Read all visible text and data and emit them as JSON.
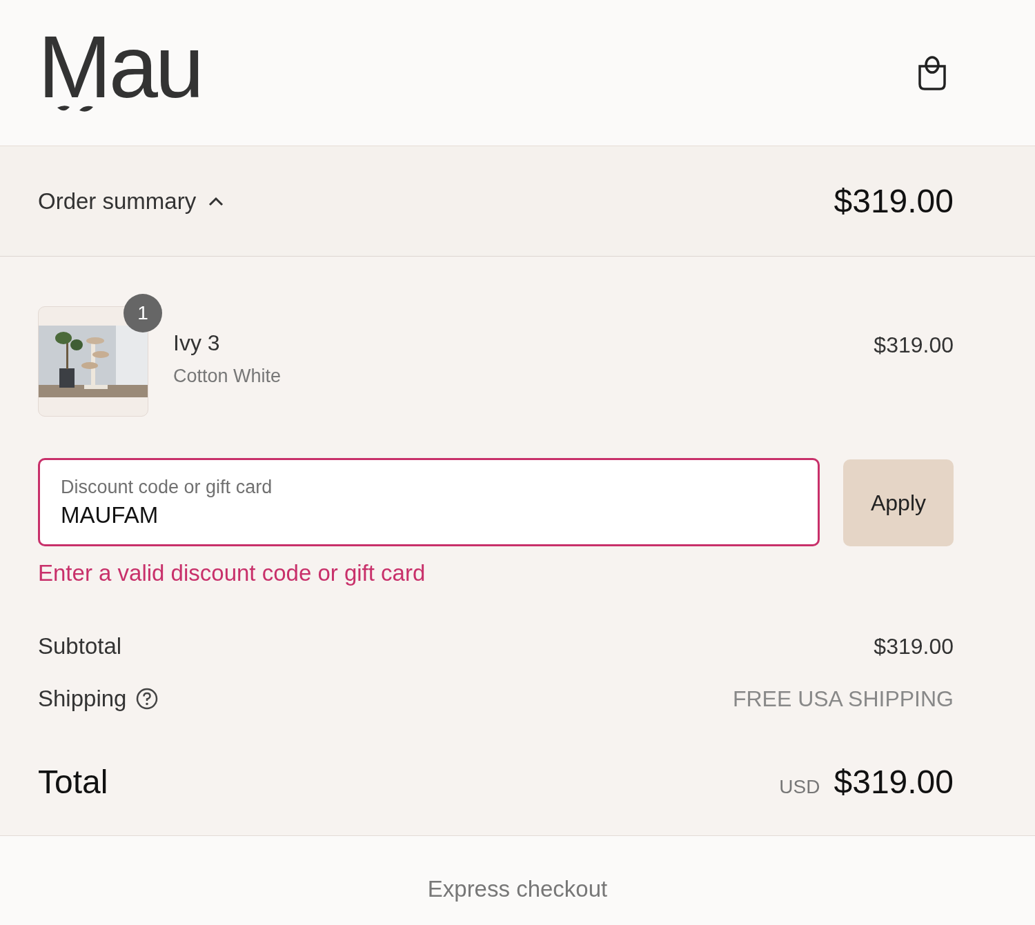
{
  "header": {
    "logo": "Mau"
  },
  "summary_toggle": {
    "label": "Order summary",
    "expanded": true,
    "total": "$319.00"
  },
  "items": [
    {
      "quantity": "1",
      "name": "Ivy 3",
      "variant": "Cotton White",
      "price": "$319.00"
    }
  ],
  "discount": {
    "label": "Discount code or gift card",
    "value": "MAUFAM",
    "invalid": true,
    "error": "Enter a valid discount code or gift card",
    "button": "Apply"
  },
  "lines": [
    {
      "kind": "amount",
      "label": "Subtotal",
      "value": "$319.00"
    },
    {
      "kind": "shipping",
      "label": "Shipping",
      "value": "FREE USA SHIPPING"
    }
  ],
  "total": {
    "label": "Total",
    "currency": "USD",
    "amount": "$319.00"
  },
  "express_checkout": {
    "label": "Express checkout"
  }
}
